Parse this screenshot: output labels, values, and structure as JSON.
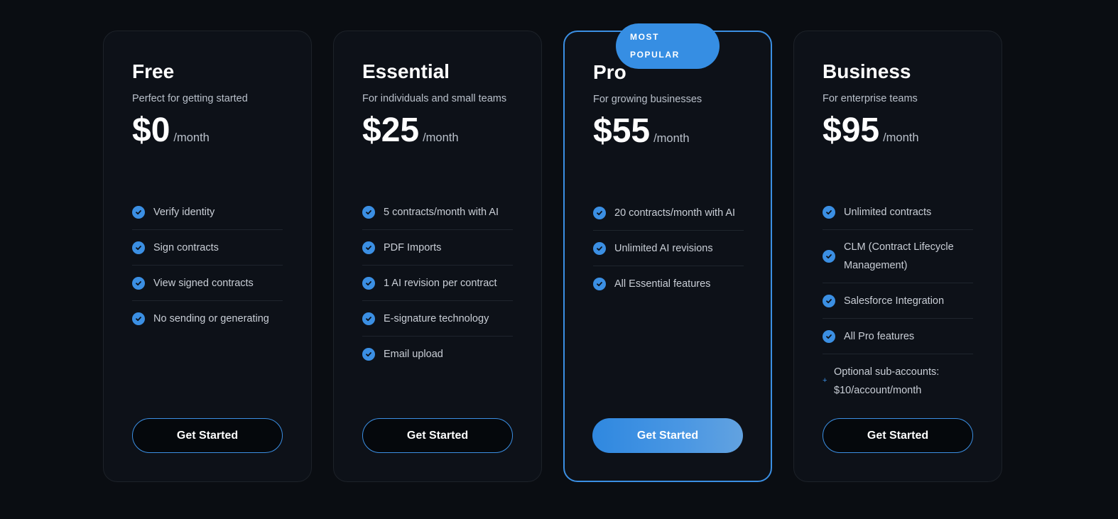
{
  "plans": [
    {
      "name": "Free",
      "description": "Perfect for getting started",
      "price": "$0",
      "period": "/month",
      "features": [
        "Verify identity",
        "Sign contracts",
        "View signed contracts",
        "No sending or generating"
      ],
      "cta": "Get Started"
    },
    {
      "name": "Essential",
      "description": "For individuals and small teams",
      "price": "$25",
      "period": "/month",
      "features": [
        "5 contracts/month with AI",
        "PDF Imports",
        "1 AI revision per contract",
        "E-signature technology",
        "Email upload"
      ],
      "cta": "Get Started"
    },
    {
      "badge": [
        "MOST",
        "POPULAR"
      ],
      "name": "Pro",
      "description": "For growing businesses",
      "price": "$55",
      "period": "/month",
      "features": [
        "20 contracts/month with AI",
        "Unlimited AI revisions",
        "All Essential features"
      ],
      "cta": "Get Started"
    },
    {
      "name": "Business",
      "description": "For enterprise teams",
      "price": "$95",
      "period": "/month",
      "features": [
        "Unlimited contracts",
        "CLM (Contract Lifecycle Management)",
        "Salesforce Integration",
        "All Pro features"
      ],
      "addon": "Optional sub-accounts: $10/account/month",
      "cta": "Get Started"
    }
  ],
  "icons": {
    "check": "check-circle-icon",
    "plus": "plus-icon"
  },
  "colors": {
    "accent": "#3b8fe3",
    "background": "#0a0d12",
    "card": "#0d1118"
  }
}
